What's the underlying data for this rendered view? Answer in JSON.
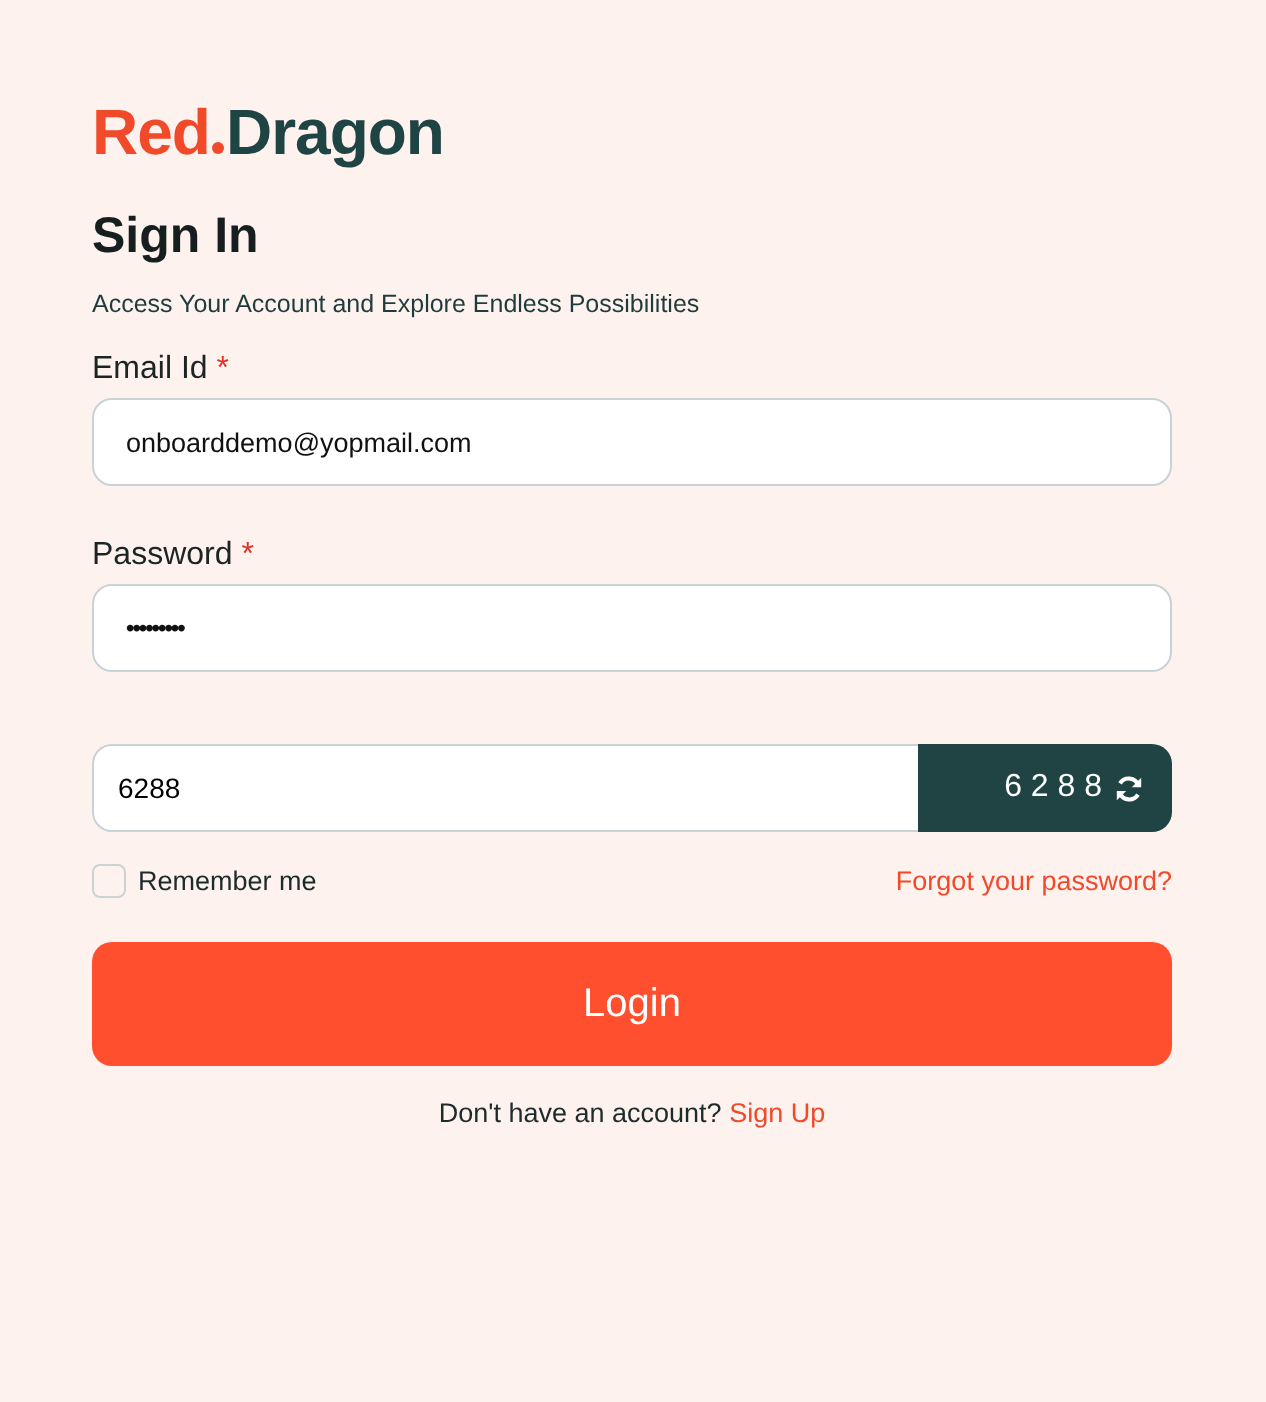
{
  "logo": {
    "parts": [
      "Red",
      "Dragon"
    ]
  },
  "title": "Sign In",
  "subtitle": "Access Your Account and Explore Endless Possibilities",
  "fields": [
    {
      "label": "Email Id",
      "required_mark": "*",
      "value": "onboarddemo@yopmail.com"
    },
    {
      "label": "Password",
      "required_mark": "*",
      "value": "•••••••••"
    }
  ],
  "captcha": {
    "value": "6288",
    "code": "6 2 8 8"
  },
  "remember": {
    "label": "Remember me",
    "checked": false
  },
  "forgot_link": "Forgot your password?",
  "login_button": "Login",
  "signup": {
    "prompt": "Don't have an account?",
    "link": "Sign Up"
  }
}
